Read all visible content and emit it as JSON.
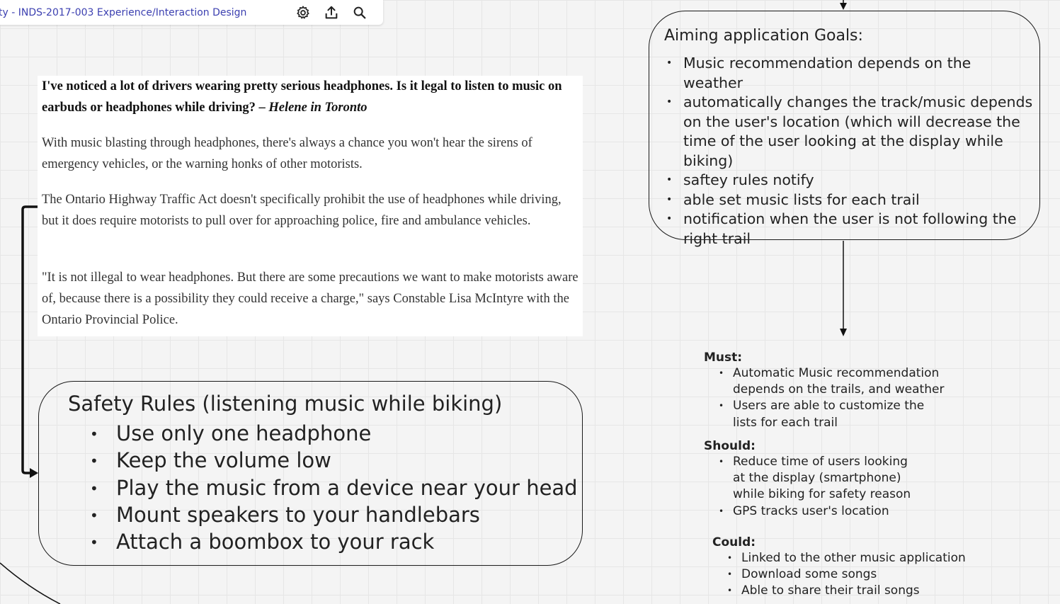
{
  "board": {
    "title": "ty - INDS-2017-003 Experience/Interaction Design",
    "icons": [
      "settings-icon",
      "share-upload-icon",
      "search-icon"
    ]
  },
  "article": {
    "question": "I've noticed a lot of drivers wearing pretty serious headphones. Is it legal to listen to music on earbuds or headphones while driving? –",
    "question_author": " Helene in Toronto",
    "p1": "With music blasting through headphones, there's always a chance you won't hear the sirens of emergency vehicles, or the warning honks of other motorists.",
    "p2": "The Ontario Highway Traffic Act doesn't specifically prohibit the use of headphones while driving, but it does require motorists to pull over for approaching police, fire and ambulance vehicles.",
    "p3": "\"It is not illegal to wear headphones. But there are some precautions we want to make motorists aware of, because there is a possibility they could receive a charge,\" says Constable Lisa McIntyre with the Ontario Provincial Police."
  },
  "goals": {
    "title": "Aiming application Goals:",
    "items": [
      "Music recommendation depends on the weather",
      "automatically changes the track/music depends on the user's location (which will decrease the time of the user looking at the display while biking)",
      "saftey rules notify",
      "able set music lists for each trail",
      "notification when the user is not following the right trail"
    ]
  },
  "safety": {
    "title": "Safety Rules (listening music while biking)",
    "items": [
      "Use only one headphone",
      "Keep the volume low",
      "Play the music from a device near your head",
      "Mount speakers to your handlebars",
      "Attach a boombox to your rack"
    ]
  },
  "moscow": {
    "must": {
      "label": "Must:",
      "items": [
        "Automatic Music recommendation depends on the trails, and weather",
        "Users are able to customize the lists for each trail"
      ]
    },
    "should": {
      "label": "Should:",
      "items": [
        "Reduce time of users looking at the display (smartphone) while biking for safety reason",
        "GPS tracks user's location"
      ]
    },
    "could": {
      "label": "Could:",
      "items": [
        "Linked to the other music application",
        "Download some songs",
        "Able to share their trail songs"
      ]
    }
  }
}
